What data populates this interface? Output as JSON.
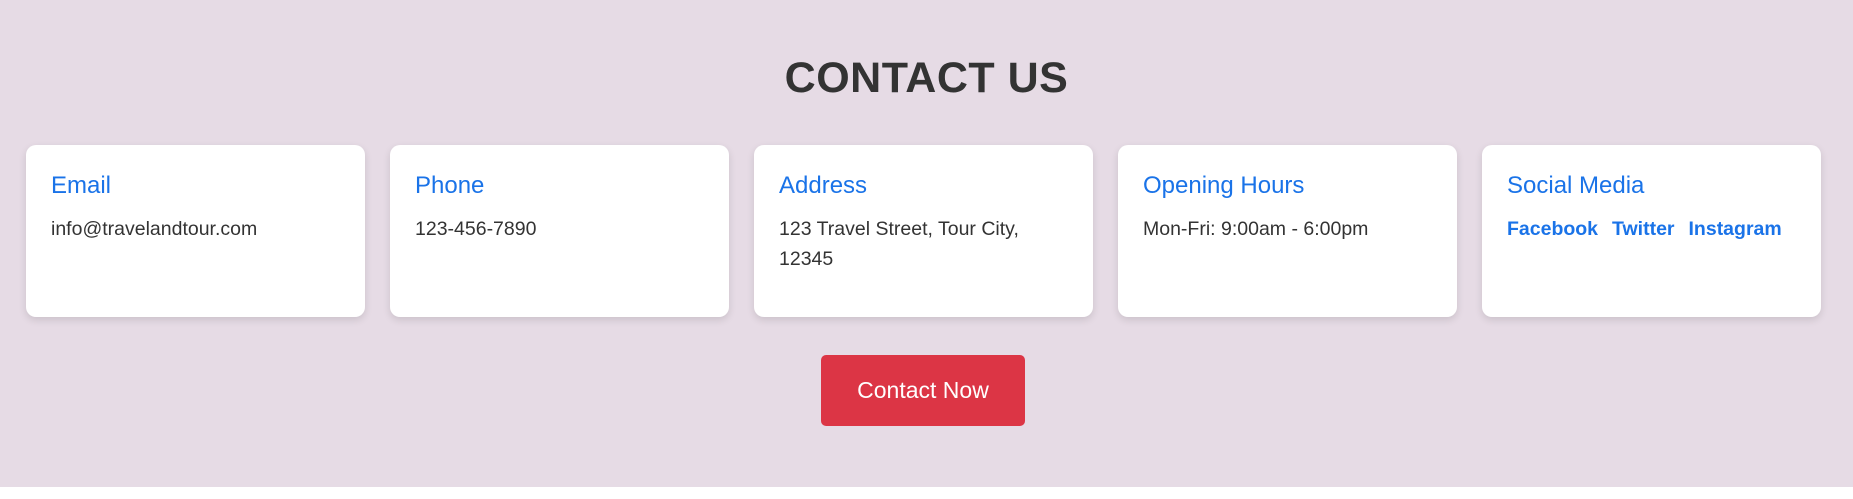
{
  "section": {
    "title": "CONTACT US"
  },
  "cards": [
    {
      "title": "Email",
      "text": "info@travelandtour.com"
    },
    {
      "title": "Phone",
      "text": "123-456-7890"
    },
    {
      "title": "Address",
      "text": "123 Travel Street, Tour City, 12345"
    },
    {
      "title": "Opening Hours",
      "text": "Mon-Fri: 9:00am - 6:00pm"
    },
    {
      "title": "Social Media",
      "links": [
        "Facebook",
        "Twitter",
        "Instagram"
      ]
    }
  ],
  "cta": {
    "label": "Contact Now"
  },
  "colors": {
    "section_bg": "#e6dbe5",
    "card_title": "#1a73e8",
    "button_bg": "#dc3545",
    "text": "#333333"
  }
}
